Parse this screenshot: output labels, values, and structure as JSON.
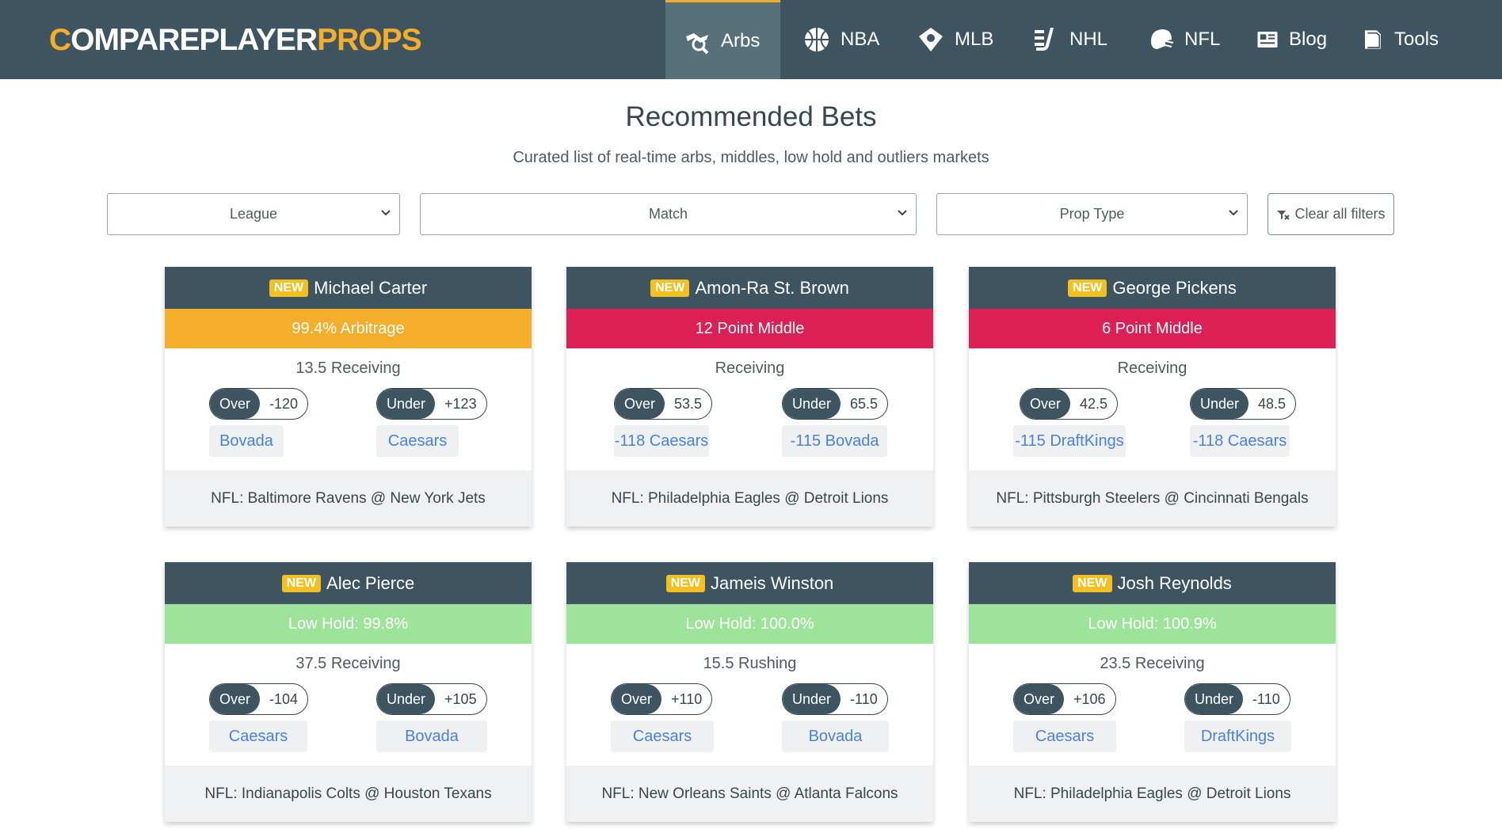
{
  "brand": {
    "first": "C",
    "middle": "OMPAREPLAYER",
    "last": "PROPS"
  },
  "nav": [
    {
      "label": "Arbs",
      "icon": "arbs-icon",
      "active": true
    },
    {
      "label": "NBA",
      "icon": "basketball-icon"
    },
    {
      "label": "MLB",
      "icon": "baseball-icon"
    },
    {
      "label": "NHL",
      "icon": "hockey-icon"
    },
    {
      "label": "NFL",
      "icon": "football-helmet-icon"
    },
    {
      "label": "Blog",
      "icon": "newspaper-icon"
    },
    {
      "label": "Tools",
      "icon": "book-icon"
    }
  ],
  "header": {
    "title": "Recommended Bets",
    "subtitle": "Curated list of real-time arbs, middles, low hold and outliers markets"
  },
  "filters": {
    "league": "League",
    "match": "Match",
    "prop_type": "Prop Type",
    "clear": "Clear all filters"
  },
  "colors": {
    "arbitrage": "#f4ae2b",
    "middle": "#dc1f55",
    "low_hold": "#9ee39a",
    "navy": "#3e5561",
    "link": "#4a7fe6"
  },
  "cards": [
    {
      "badge": "NEW",
      "player": "Michael Carter",
      "banner": "99.4% Arbitrage",
      "banner_type": "arbitrage",
      "market": "13.5 Receiving",
      "over": {
        "side": "Over",
        "value": "-120",
        "book": "Bovada"
      },
      "under": {
        "side": "Under",
        "value": "+123",
        "book": "Caesars"
      },
      "match": "NFL: Baltimore Ravens @ New York Jets"
    },
    {
      "badge": "NEW",
      "player": "Amon-Ra St. Brown",
      "banner": "12 Point Middle",
      "banner_type": "middle",
      "market": "Receiving",
      "over": {
        "side": "Over",
        "value": "53.5",
        "book": "-118 Caesars"
      },
      "under": {
        "side": "Under",
        "value": "65.5",
        "book": "-115 Bovada"
      },
      "match": "NFL: Philadelphia Eagles @ Detroit Lions"
    },
    {
      "badge": "NEW",
      "player": "George Pickens",
      "banner": "6 Point Middle",
      "banner_type": "middle",
      "market": "Receiving",
      "over": {
        "side": "Over",
        "value": "42.5",
        "book": "-115 DraftKings"
      },
      "under": {
        "side": "Under",
        "value": "48.5",
        "book": "-118 Caesars"
      },
      "match": "NFL: Pittsburgh Steelers @ Cincinnati Bengals"
    },
    {
      "badge": "NEW",
      "player": "Alec Pierce",
      "banner": "Low Hold: 99.8%",
      "banner_type": "low_hold",
      "market": "37.5 Receiving",
      "over": {
        "side": "Over",
        "value": "-104",
        "book": "Caesars"
      },
      "under": {
        "side": "Under",
        "value": "+105",
        "book": "Bovada"
      },
      "match": "NFL: Indianapolis Colts @ Houston Texans"
    },
    {
      "badge": "NEW",
      "player": "Jameis Winston",
      "banner": "Low Hold: 100.0%",
      "banner_type": "low_hold",
      "market": "15.5 Rushing",
      "over": {
        "side": "Over",
        "value": "+110",
        "book": "Caesars"
      },
      "under": {
        "side": "Under",
        "value": "-110",
        "book": "Bovada"
      },
      "match": "NFL: New Orleans Saints @ Atlanta Falcons"
    },
    {
      "badge": "NEW",
      "player": "Josh Reynolds",
      "banner": "Low Hold: 100.9%",
      "banner_type": "low_hold",
      "market": "23.5 Receiving",
      "over": {
        "side": "Over",
        "value": "+106",
        "book": "Caesars"
      },
      "under": {
        "side": "Under",
        "value": "-110",
        "book": "DraftKings"
      },
      "match": "NFL: Philadelphia Eagles @ Detroit Lions"
    }
  ]
}
